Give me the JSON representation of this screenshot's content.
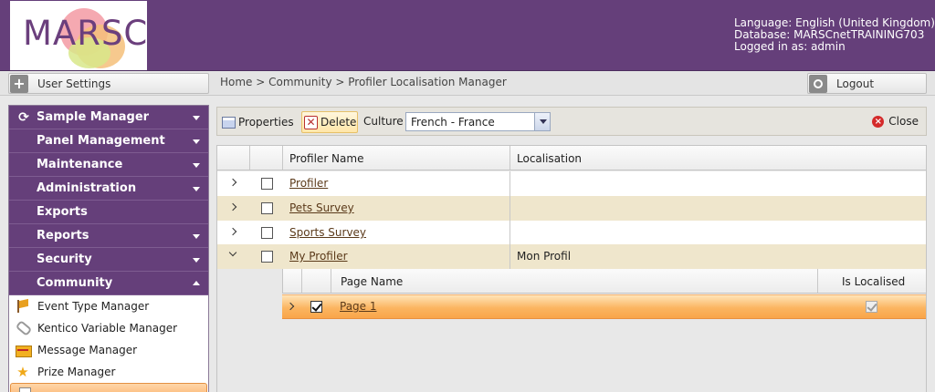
{
  "header": {
    "logo_text": "MARSC",
    "language": "Language: English (United Kingdom)",
    "database": "Database: MARSCnetTRAINING703",
    "logged_in": "Logged in as: admin"
  },
  "topbar": {
    "user_settings": "User Settings",
    "breadcrumb": "Home > Community > Profiler Localisation Manager",
    "logout": "Logout"
  },
  "sidebar": {
    "sections": [
      {
        "label": "Sample Manager",
        "icon": "refresh-icon",
        "expanded": false
      },
      {
        "label": "Panel Management",
        "expanded": false
      },
      {
        "label": "Maintenance",
        "expanded": false
      },
      {
        "label": "Administration",
        "expanded": false
      },
      {
        "label": "Exports"
      },
      {
        "label": "Reports",
        "expanded": false
      },
      {
        "label": "Security",
        "expanded": false
      },
      {
        "label": "Community",
        "expanded": true
      }
    ],
    "community_items": [
      {
        "label": "Event Type Manager",
        "icon": "flag-icon"
      },
      {
        "label": "Kentico Variable Manager",
        "icon": "paperclip-icon"
      },
      {
        "label": "Message Manager",
        "icon": "message-icon"
      },
      {
        "label": "Prize Manager",
        "icon": "star-icon"
      }
    ]
  },
  "toolbar": {
    "properties": "Properties",
    "delete": "Delete",
    "culture_label": "Culture",
    "culture_value": "French - France",
    "close": "Close"
  },
  "grid": {
    "columns": [
      "Profiler Name",
      "Localisation"
    ],
    "rows": [
      {
        "name": "Profiler",
        "localisation": ""
      },
      {
        "name": "Pets Survey",
        "localisation": ""
      },
      {
        "name": "Sports Survey",
        "localisation": ""
      },
      {
        "name": "My Profiler",
        "localisation": "Mon Profil",
        "expanded": true
      }
    ],
    "detail": {
      "columns": [
        "Page Name",
        "Is Localised"
      ],
      "rows": [
        {
          "name": "Page 1",
          "is_localised": true
        }
      ]
    }
  },
  "colors": {
    "header_purple": "#653f7a",
    "alt_row": "#efe6cc",
    "selected_row": "#f9a549",
    "link": "#5b3a1a"
  }
}
